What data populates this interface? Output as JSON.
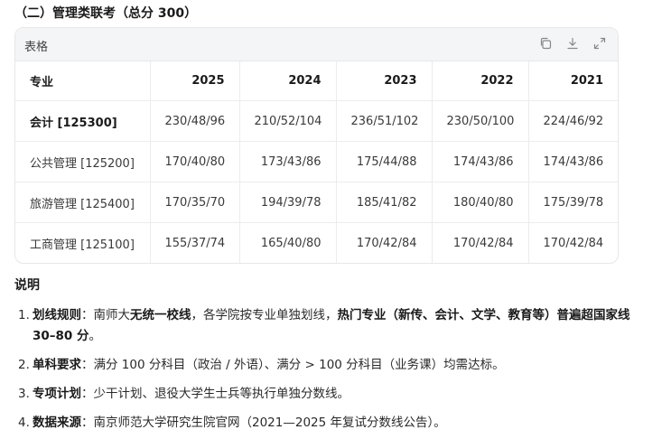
{
  "heading": "（二）管理类联考（总分 300）",
  "table_card": {
    "title": "表格",
    "tools": {
      "copy_icon": "copy-icon",
      "download_icon": "download-icon",
      "expand_icon": "expand-icon"
    },
    "columns": [
      "专业",
      "2025",
      "2024",
      "2023",
      "2022",
      "2021"
    ],
    "rows": [
      [
        "会计 [125300]",
        "230/48/96",
        "210/52/104",
        "236/51/102",
        "230/50/100",
        "224/46/92"
      ],
      [
        "公共管理 [125200]",
        "170/40/80",
        "173/43/86",
        "175/44/88",
        "174/43/86",
        "174/43/86"
      ],
      [
        "旅游管理 [125400]",
        "170/35/70",
        "194/39/78",
        "185/41/82",
        "180/40/80",
        "175/39/78"
      ],
      [
        "工商管理 [125100]",
        "155/37/74",
        "165/40/80",
        "170/42/84",
        "170/42/84",
        "170/42/84"
      ]
    ]
  },
  "notes": {
    "title": "说明",
    "items": [
      {
        "num": "1.",
        "label": "划线规则",
        "sep": "：",
        "t1": "南师大",
        "b1": "无统一校线",
        "t2": "，各学院按专业单独划线，",
        "b2": "热门专业（新传、会计、文学、教育等）普遍超国家线 30–80 分",
        "t3": "。"
      },
      {
        "num": "2.",
        "label": "单科要求",
        "sep": "：",
        "text": "满分 100 分科目（政治 / 外语）、满分 > 100 分科目（业务课）均需达标。"
      },
      {
        "num": "3.",
        "label": "专项计划",
        "sep": "：",
        "text": "少干计划、退役大学生士兵等执行单独分数线。"
      },
      {
        "num": "4.",
        "label": "数据来源",
        "sep": "：",
        "text": "南京师范大学研究生院官网（2021—2025 年复试分数线公告）。"
      }
    ]
  }
}
